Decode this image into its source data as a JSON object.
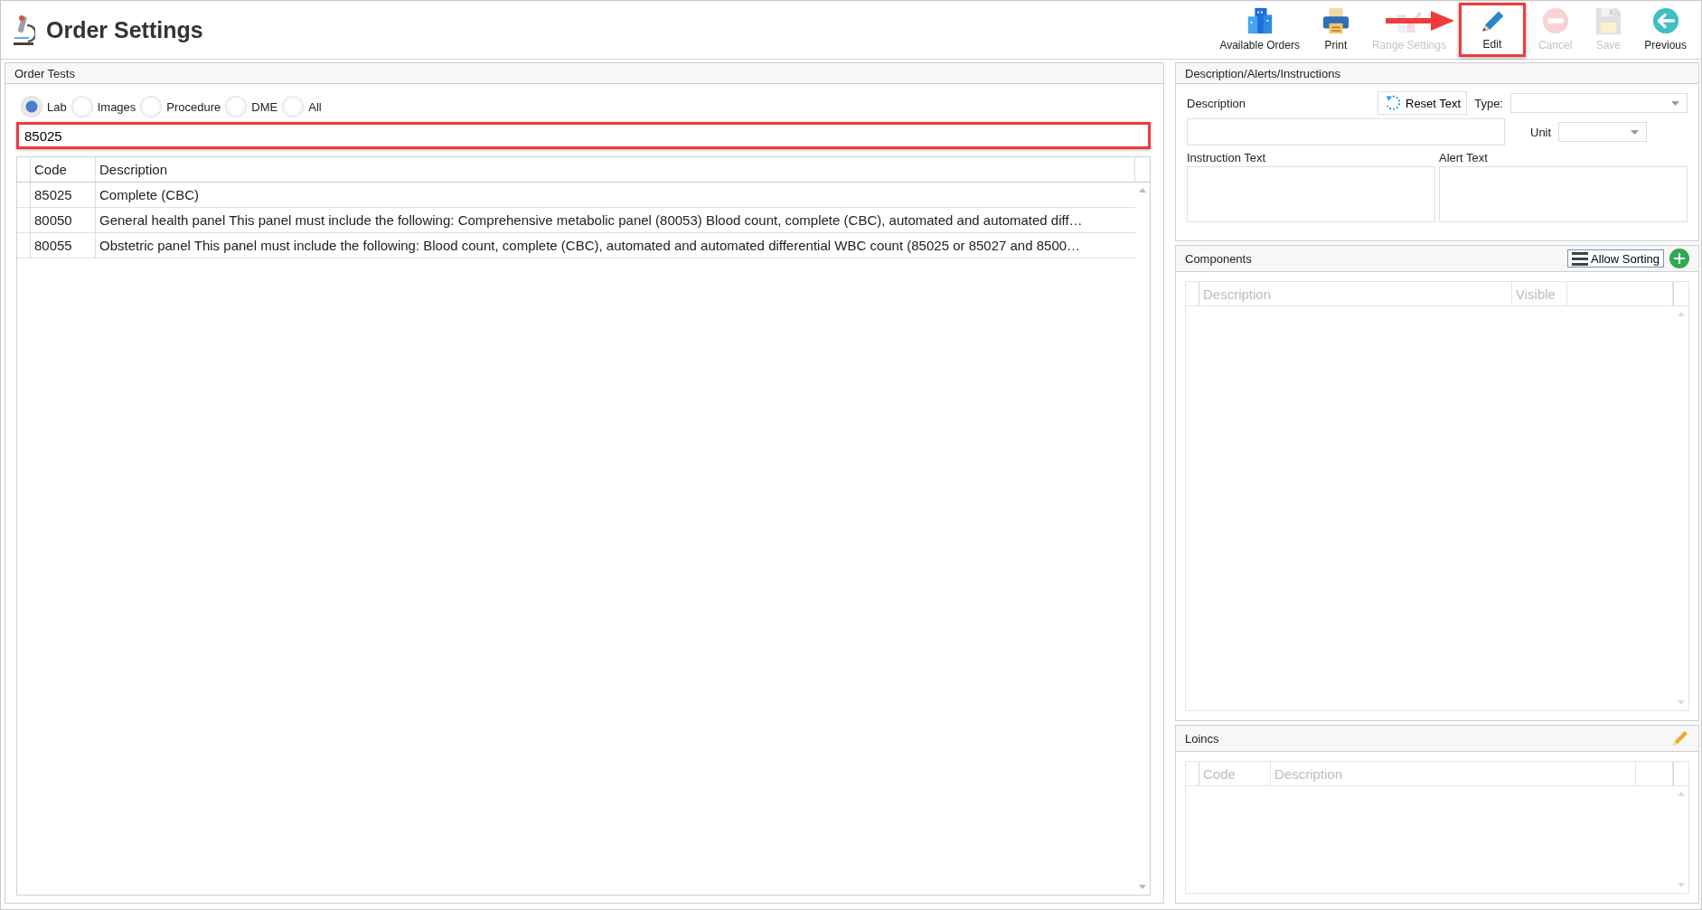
{
  "window": {
    "title": "Order Settings"
  },
  "toolbar": [
    {
      "label": "Available Orders",
      "kind": "orders",
      "disabled": false,
      "highlighted": false
    },
    {
      "label": "Print",
      "kind": "print",
      "disabled": false,
      "highlighted": false
    },
    {
      "label": "Range Settings",
      "kind": "range",
      "disabled": true,
      "highlighted": false
    },
    {
      "label": "Edit",
      "kind": "edit",
      "disabled": false,
      "highlighted": true
    },
    {
      "label": "Cancel",
      "kind": "cancel",
      "disabled": true,
      "highlighted": false
    },
    {
      "label": "Save",
      "kind": "save",
      "disabled": true,
      "highlighted": false
    },
    {
      "label": "Previous",
      "kind": "previous",
      "disabled": false,
      "highlighted": false
    }
  ],
  "order_tests": {
    "title": "Order Tests",
    "filters": [
      {
        "label": "Lab",
        "selected": true
      },
      {
        "label": "Images",
        "selected": false
      },
      {
        "label": "Procedure",
        "selected": false
      },
      {
        "label": "DME",
        "selected": false
      },
      {
        "label": "All",
        "selected": false
      }
    ],
    "search": {
      "value": "85025",
      "highlighted": true
    },
    "table": {
      "columns": [
        "Code",
        "Description"
      ],
      "rows": [
        [
          "85025",
          "Complete (CBC)"
        ],
        [
          "80050",
          "General health panel This panel must include the following: Comprehensive metabolic panel (80053) Blood count, complete (CBC), automated and automated diff…"
        ],
        [
          "80055",
          "Obstetric panel This panel must include the following: Blood count, complete (CBC), automated and automated differential WBC count (85025 or 85027 and 8500…"
        ]
      ]
    }
  },
  "description_panel": {
    "title": "Description/Alerts/Instructions",
    "description_label": "Description",
    "reset_button": "Reset Text",
    "type_label": "Type:",
    "unit_label": "Unit",
    "instruction_label": "Instruction Text",
    "alert_label": "Alert Text"
  },
  "components": {
    "title": "Components",
    "sort_button": "Allow Sorting",
    "columns": [
      "Description",
      "Visible"
    ]
  },
  "loincs": {
    "title": "Loincs",
    "columns": [
      "Code",
      "Description"
    ]
  }
}
